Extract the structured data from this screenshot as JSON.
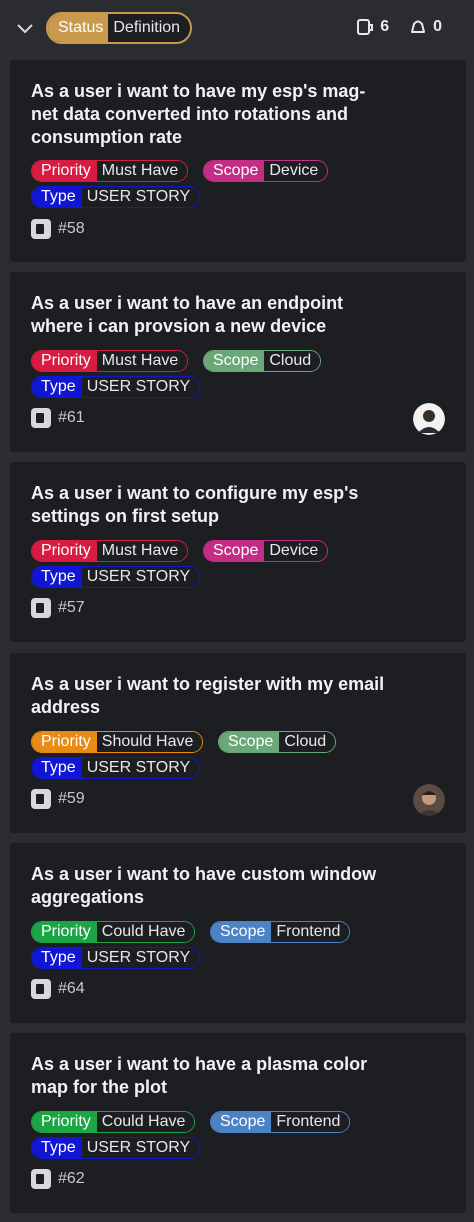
{
  "header": {
    "group_key": "Status",
    "group_value": "Definition",
    "count_items": "6",
    "count_alerts": "0"
  },
  "cards": [
    {
      "title": "As a user i want to have my esp's mag-net data converted into rotations and consumption rate",
      "title_lines": [
        "As a user i want to have my esp's mag-",
        "net data converted into rotations and",
        "consumption rate"
      ],
      "priority_key": "Priority",
      "priority": "Must Have",
      "scope_key": "Scope",
      "scope": "Device",
      "type_key": "Type",
      "type": "USER STORY",
      "number": "#58",
      "avatar": false
    },
    {
      "title_lines": [
        "As a user i want to have an endpoint",
        "where i can provsion a new device"
      ],
      "priority_key": "Priority",
      "priority": "Must Have",
      "scope_key": "Scope",
      "scope": "Cloud",
      "type_key": "Type",
      "type": "USER STORY",
      "number": "#61",
      "avatar": true
    },
    {
      "title_lines": [
        "As a user i want to configure my esp's",
        "settings on first setup"
      ],
      "priority_key": "Priority",
      "priority": "Must Have",
      "scope_key": "Scope",
      "scope": "Device",
      "type_key": "Type",
      "type": "USER STORY",
      "number": "#57",
      "avatar": false
    },
    {
      "title_lines": [
        "As a user i want to register with my email",
        "address"
      ],
      "priority_key": "Priority",
      "priority": "Should Have",
      "scope_key": "Scope",
      "scope": "Cloud",
      "type_key": "Type",
      "type": "USER STORY",
      "number": "#59",
      "avatar": true
    },
    {
      "title_lines": [
        "As a user i want to have custom window",
        "aggregations"
      ],
      "priority_key": "Priority",
      "priority": "Could Have",
      "scope_key": "Scope",
      "scope": "Frontend",
      "type_key": "Type",
      "type": "USER STORY",
      "number": "#64",
      "avatar": false
    },
    {
      "title_lines": [
        "As a user i want to have a plasma color",
        "map for the plot"
      ],
      "priority_key": "Priority",
      "priority": "Could Have",
      "scope_key": "Scope",
      "scope": "Frontend",
      "type_key": "Type",
      "type": "USER STORY",
      "number": "#62",
      "avatar": false
    }
  ],
  "icons": {
    "collapse": "chevron-down-icon",
    "items": "issue-icon",
    "alerts": "bell-icon"
  }
}
